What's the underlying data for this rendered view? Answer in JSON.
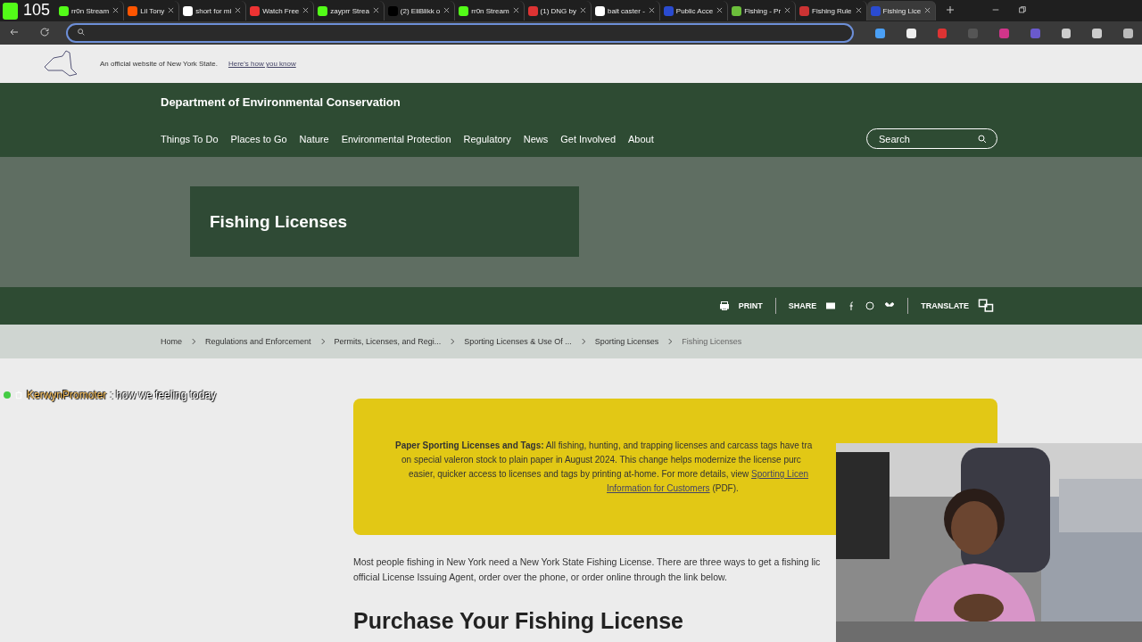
{
  "overlay": {
    "viewer_count": "105",
    "chat": {
      "user": "KerwynPromoter",
      "message": ": how we feeling today"
    }
  },
  "tabs": [
    {
      "title": "rr0n Stream",
      "selected": false
    },
    {
      "title": "Lil Tony",
      "selected": false
    },
    {
      "title": "short for mi",
      "selected": false
    },
    {
      "title": "Watch Free",
      "selected": false
    },
    {
      "title": "zayprr Strea",
      "selected": false
    },
    {
      "title": "(2) EliBlikk o",
      "selected": false
    },
    {
      "title": "rr0n Stream",
      "selected": false
    },
    {
      "title": "(1) DNG by",
      "selected": false
    },
    {
      "title": "bait caster -",
      "selected": false
    },
    {
      "title": "Public Acce",
      "selected": false
    },
    {
      "title": "Fishing - Pr",
      "selected": false
    },
    {
      "title": "Fishing Rule",
      "selected": false
    },
    {
      "title": "Fishing Lice",
      "selected": true
    }
  ],
  "gov_banner": {
    "text": "An official website of New York State.",
    "link": "Here's how you know"
  },
  "site": {
    "title": "Department of Environmental Conservation",
    "nav": [
      "Things To Do",
      "Places to Go",
      "Nature",
      "Environmental Protection",
      "Regulatory",
      "News",
      "Get Involved",
      "About"
    ],
    "search_placeholder": "Search"
  },
  "page_title": "Fishing Licenses",
  "actions": {
    "print": "PRINT",
    "share": "SHARE",
    "translate": "TRANSLATE"
  },
  "breadcrumb": [
    "Home",
    "Regulations and Enforcement",
    "Permits, Licenses, and Regi...",
    "Sporting Licenses & Use Of ...",
    "Sporting Licenses",
    "Fishing Licenses"
  ],
  "notice": {
    "lines": [
      "**Paper Sporting Licenses and Tags:** All fishing, hunting, and trapping licenses and carcass tags have tra",
      "on special valeron stock to plain paper in August 2024. This change helps modernize the license purc",
      "easier, quicker access to licenses and tags by printing at-home. For more details, view "
    ],
    "link_part_1": "Sporting Licen",
    "link_part_2": "Information for Customers",
    "after_link": " (PDF)."
  },
  "intro": [
    "Most people fishing in New York need a New York State Fishing License. There are three ways to get a fishing lic",
    "official License Issuing Agent, order over the phone, or order online through the link below."
  ],
  "heading": "Purchase Your Fishing License",
  "webcam": {
    "kind": "picture"
  }
}
